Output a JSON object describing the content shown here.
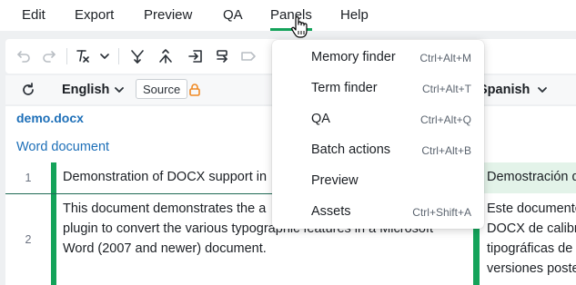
{
  "menubar": {
    "items": [
      {
        "label": "Edit"
      },
      {
        "label": "Export"
      },
      {
        "label": "Preview"
      },
      {
        "label": "QA"
      },
      {
        "label": "Panels"
      },
      {
        "label": "Help"
      }
    ]
  },
  "toolbar": {
    "icons": [
      "undo-icon",
      "redo-icon",
      "clear-formatting-icon",
      "chevron-down-icon",
      "merge-segments-icon",
      "split-segment-icon",
      "insert-source-icon",
      "copy-source-icon",
      "tag-icon"
    ]
  },
  "language_bar": {
    "source_language": "English",
    "source_pill": "Source",
    "target_language": "Spanish"
  },
  "document": {
    "file_name": "demo.docx",
    "doc_type": "Word document",
    "segments": [
      {
        "number": "1",
        "source": [
          "Demonstration of DOCX support in"
        ],
        "target": [
          "Demostración d"
        ]
      },
      {
        "number": "2",
        "source": [
          "This document demonstrates the a",
          "plugin to convert the various typographic features in a Microsoft",
          "Word (2007 and newer) document."
        ],
        "target": [
          "Este documento",
          "DOCX de calibre",
          "tipográficas de",
          "versiones poste"
        ]
      }
    ]
  },
  "panels_menu": {
    "items": [
      {
        "label": "Memory finder",
        "shortcut": "Ctrl+Alt+M"
      },
      {
        "label": "Term finder",
        "shortcut": "Ctrl+Alt+T"
      },
      {
        "label": "QA",
        "shortcut": "Ctrl+Alt+Q"
      },
      {
        "label": "Batch actions",
        "shortcut": "Ctrl+Alt+B"
      },
      {
        "label": "Preview",
        "shortcut": ""
      },
      {
        "label": "Assets",
        "shortcut": "Ctrl+Shift+A"
      }
    ]
  },
  "colors": {
    "accent_green": "#14a35a",
    "link_blue": "#1d6fb8",
    "lock_orange": "#f08a24"
  }
}
